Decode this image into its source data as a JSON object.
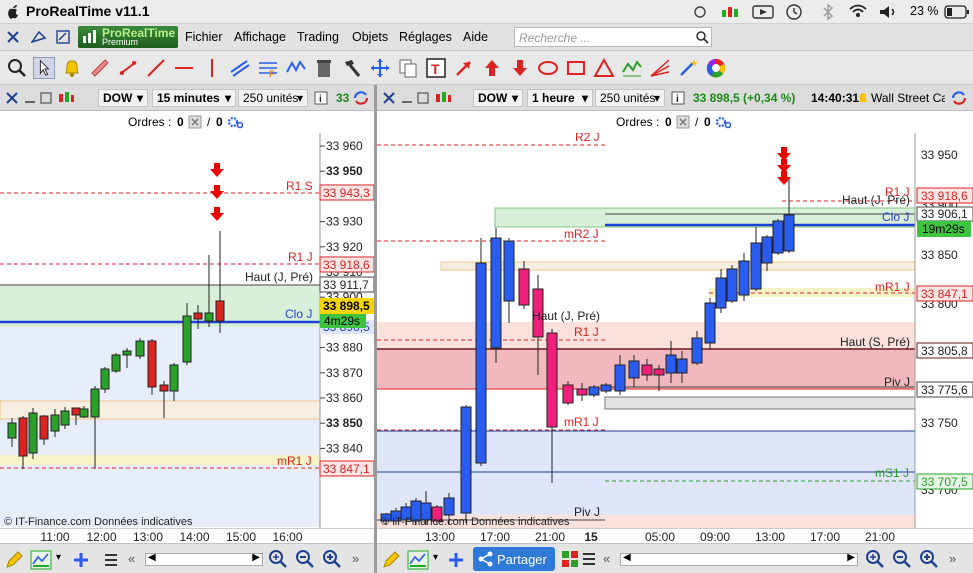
{
  "app": {
    "title": "ProRealTime v11.1",
    "battery": "23 %",
    "brand_line1": "ProRealTime",
    "brand_line2": "Premium"
  },
  "menu": [
    "Fichier",
    "Affichage",
    "Trading",
    "Objets",
    "Réglages",
    "Aide"
  ],
  "search": {
    "placeholder": "Recherche ..."
  },
  "left_panel": {
    "instrument": "DOW",
    "timeframe": "15 minutes",
    "units": "250 unités",
    "price_short": "33",
    "orders_label": "Ordres :",
    "orders_count_a": "0",
    "orders_count_b": "0",
    "price_axis": [
      "33 960",
      "33 950",
      "33 940",
      "33 930",
      "33 920",
      "33 910",
      "33 900",
      "33 890",
      "33 880",
      "33 870",
      "33 860",
      "33 850",
      "33 840"
    ],
    "level_tags": {
      "r1s": "33 943,3",
      "r1j": "33 918,6",
      "haut": "33 911,7",
      "last": "33 898,5",
      "clo": "33 896,5",
      "countdown": "4m29s",
      "mr1j": "33 847,1"
    },
    "line_labels": {
      "r1s": "R1 S",
      "r1j": "R1 J",
      "haut": "Haut (J, Pré)",
      "clo": "Clo J",
      "mr1j": "mR1 J"
    },
    "time_axis": [
      "11:00",
      "12:00",
      "13:00",
      "14:00",
      "15:00",
      "16:00"
    ],
    "watermark": "© IT-Finance.com  Données indicatives"
  },
  "right_panel": {
    "instrument": "DOW",
    "timeframe": "1 heure",
    "units": "250 unités",
    "quote": "33 898,5 (+0,34 %)",
    "time": "14:40:31",
    "name": "Wall Street Ca",
    "orders_label": "Ordres :",
    "orders_count_a": "0",
    "orders_count_b": "0",
    "price_axis": [
      "33 950",
      "33 900",
      "33 850",
      "33 800",
      "33 750",
      "33 700"
    ],
    "level_tags": {
      "r1j": "33 918,6",
      "haut": "33 906,1",
      "countdown": "19m29s",
      "mr1j": "33 847,1",
      "hautS": "33 805,8",
      "piv": "33 775,6",
      "ms1": "33 707,5"
    },
    "line_labels": {
      "r2j": "R2 J",
      "r1j": "R1 J",
      "haut": "Haut (J, Pré)",
      "clo": "Clo J",
      "mr2j": "mR2 J",
      "mr1j_top": "mR1 J",
      "haut_jp_mid": "Haut (J, Pré)",
      "r1j_mid": "R1 J",
      "hautS": "Haut (S, Pré)",
      "pivj": "Piv J",
      "mr1j_low": "mR1 J",
      "ms1j": "mS1 J",
      "pivj_low": "Piv J"
    },
    "time_axis": [
      "13:00",
      "17:00",
      "21:00",
      "15",
      "05:00",
      "09:00",
      "13:00",
      "17:00",
      "21:00"
    ],
    "watermark": "© IT-Finance.com  Données indicatives",
    "share": "Partager"
  },
  "colors": {
    "green": "#2aa02a",
    "red": "#d7002a",
    "blue": "#0b3fd6",
    "pink": "#f0207a",
    "bullblue": "#2a5cf0"
  }
}
